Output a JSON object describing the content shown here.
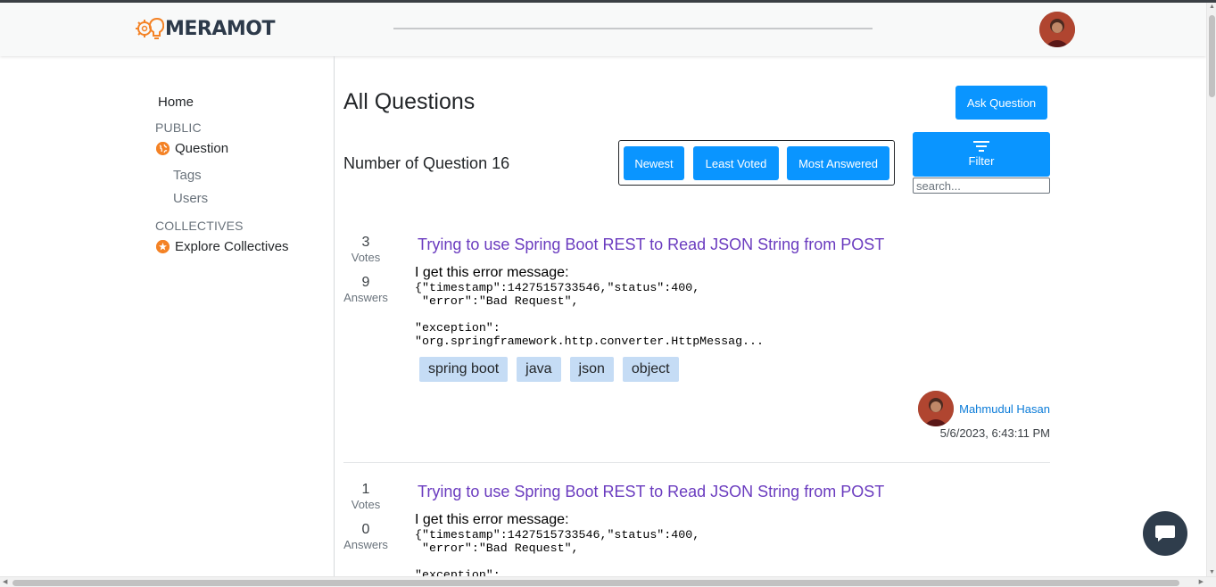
{
  "header": {
    "logo_text": "MERAMOT",
    "icons": {
      "logo": "lightbulb-gear-logo",
      "avatar": "user-avatar"
    }
  },
  "sidebar": {
    "home": "Home",
    "public_heading": "PUBLIC",
    "question": "Question",
    "tags": "Tags",
    "users": "Users",
    "collectives_heading": "COLLECTIVES",
    "explore": "Explore Collectives",
    "icons": {
      "question": "globe-icon",
      "explore": "star-badge-icon"
    },
    "accent_color": "#f48225"
  },
  "main": {
    "title": "All Questions",
    "ask_button": "Ask Question",
    "question_count": "Number of Question 16",
    "sort": {
      "newest": "Newest",
      "least_voted": "Least Voted",
      "most_answered": "Most Answered"
    },
    "filter_button": "Filter",
    "search_placeholder": "search...",
    "button_color": "#0a95ff"
  },
  "questions": [
    {
      "votes": "3",
      "votes_label": "Votes",
      "answers": "9",
      "answers_label": "Answers",
      "title": "Trying to use Spring Boot REST to Read JSON String from POST",
      "intro": "I get this error message:",
      "code": "{\"timestamp\":1427515733546,\"status\":400,\n \"error\":\"Bad Request\",\n\n\"exception\":\n\"org.springframework.http.converter.HttpMessag...",
      "tags": [
        "spring boot",
        "java",
        "json",
        "object"
      ],
      "author": "Mahmudul Hasan",
      "date": "5/6/2023, 6:43:11 PM"
    },
    {
      "votes": "1",
      "votes_label": "Votes",
      "answers": "0",
      "answers_label": "Answers",
      "title": "Trying to use Spring Boot REST to Read JSON String from POST",
      "intro": "I get this error message:",
      "code": "{\"timestamp\":1427515733546,\"status\":400,\n \"error\":\"Bad Request\",\n\n\"exception\":"
    }
  ],
  "chat": {
    "icon": "chat-bubble-icon"
  }
}
